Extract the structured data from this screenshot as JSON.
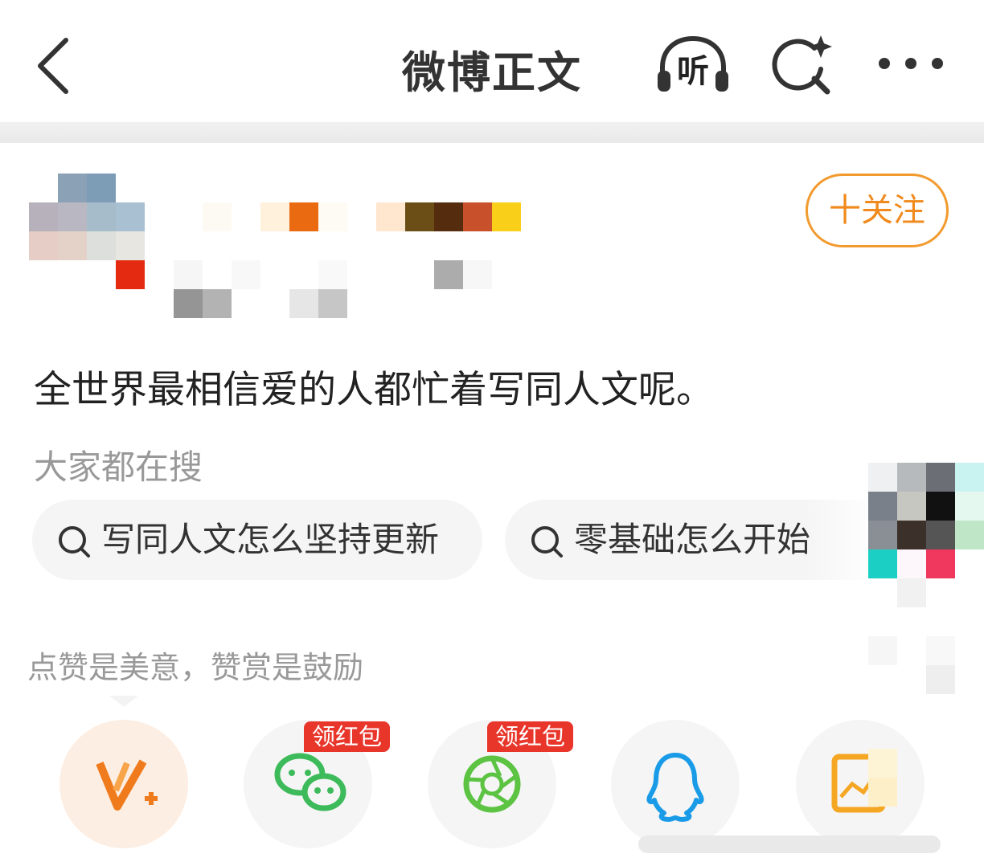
{
  "nav": {
    "title": "微博正文",
    "listen_label": "听"
  },
  "post": {
    "follow_label": "十关注",
    "text": "全世界最相信爱的人都忙着写同人文呢。"
  },
  "search": {
    "section_label": "大家都在搜",
    "chips": [
      {
        "label": "写同人文怎么坚持更新"
      },
      {
        "label": "零基础怎么开始"
      }
    ]
  },
  "tip": {
    "text": "点赞是美意，赞赏是鼓励"
  },
  "share": {
    "badges": [
      {
        "label": "领红包"
      },
      {
        "label": "领红包"
      }
    ],
    "items": [
      {
        "icon": "vplus-icon",
        "color": "#f07b1d"
      },
      {
        "icon": "wechat-icon",
        "color": "#3dbb5a"
      },
      {
        "icon": "moments-icon",
        "color": "#5cc343"
      },
      {
        "icon": "qq-icon",
        "color": "#1a9be8"
      },
      {
        "icon": "chart-icon",
        "color": "#f5a623"
      }
    ]
  },
  "colors": {
    "accent": "#f08a1c",
    "badge": "#e8362b"
  }
}
